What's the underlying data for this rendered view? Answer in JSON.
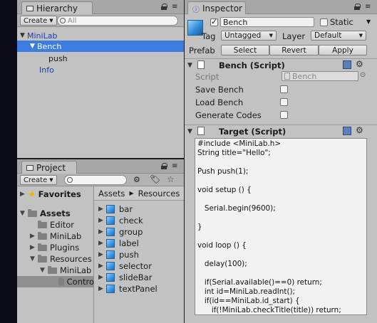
{
  "hierarchy": {
    "tab_title": "Hierarchy",
    "create_label": "Create",
    "search_placeholder": "All",
    "items": [
      {
        "label": "MiniLab"
      },
      {
        "label": "Bench"
      },
      {
        "label": "push"
      },
      {
        "label": "Info"
      }
    ]
  },
  "project": {
    "tab_title": "Project",
    "create_label": "Create",
    "favorites_label": "Favorites",
    "tree": [
      {
        "label": "Assets"
      },
      {
        "label": "Editor"
      },
      {
        "label": "MiniLab"
      },
      {
        "label": "Plugins"
      },
      {
        "label": "Resources"
      },
      {
        "label": "MiniLab"
      },
      {
        "label": "Contro"
      }
    ],
    "breadcrumbs": [
      "Assets",
      "Resources"
    ],
    "assets": [
      "bar",
      "check",
      "group",
      "label",
      "push",
      "selector",
      "slideBar",
      "textPanel"
    ]
  },
  "inspector": {
    "tab_title": "Inspector",
    "object_name": "Bench",
    "static_label": "Static",
    "tag_label": "Tag",
    "tag_value": "Untagged",
    "layer_label": "Layer",
    "layer_value": "Default",
    "prefab_label": "Prefab",
    "prefab_buttons": [
      "Select",
      "Revert",
      "Apply"
    ],
    "bench_component": {
      "title": "Bench (Script)",
      "script_label": "Script",
      "script_value": "Bench",
      "fields": [
        "Save Bench",
        "Load Bench",
        "Generate Codes"
      ]
    },
    "target_component": {
      "title": "Target (Script)",
      "code": "#include <MiniLab.h>\nString title=\"Hello\";\n\nPush push(1);\n\nvoid setup () {\n\n   Serial.begin(9600);\n\n}\n\nvoid loop () {\n\n   delay(100);\n\n   if(Serial.available()==0) return;\n   int id=MiniLab.readInt();\n   if(id==MiniLab.id_start) {\n      if(!MiniLab.checkTitle(title)) return;"
    }
  },
  "colors": {
    "selection": "#3d7ce0",
    "panel": "#c2c2c2",
    "link_blue": "#1a3fa8"
  }
}
